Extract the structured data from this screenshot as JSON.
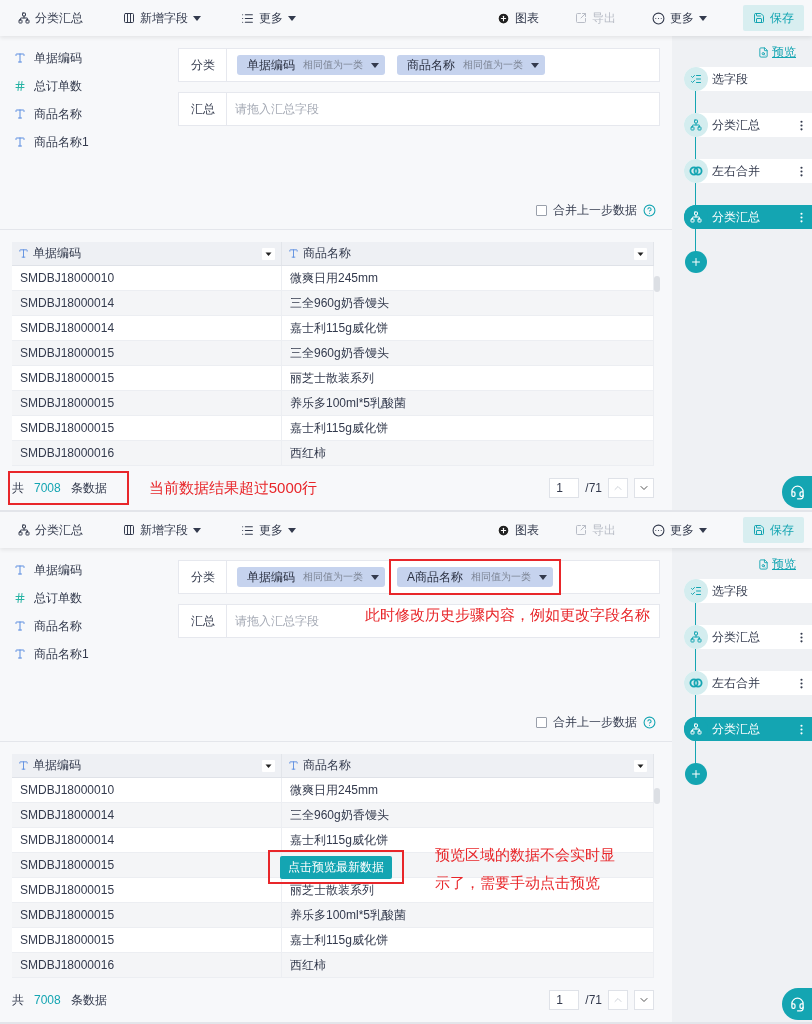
{
  "panels": [
    {
      "toolbar": {
        "left": [
          {
            "kind": "summary",
            "label": "分类汇总",
            "dropdown": false
          },
          {
            "kind": "add-field",
            "label": "新增字段",
            "dropdown": true
          },
          {
            "kind": "more",
            "label": "更多",
            "dropdown": true
          }
        ],
        "right": [
          {
            "kind": "chart",
            "label": "图表",
            "dropdown": false,
            "disabled": false
          },
          {
            "kind": "export",
            "label": "导出",
            "dropdown": false,
            "disabled": true
          },
          {
            "kind": "more-circle",
            "label": "更多",
            "dropdown": true,
            "disabled": false
          },
          {
            "kind": "save",
            "label": "保存",
            "dropdown": false,
            "disabled": false
          }
        ]
      },
      "fields": [
        {
          "kind": "text",
          "label": "单据编码"
        },
        {
          "kind": "number",
          "label": "总订单数"
        },
        {
          "kind": "text",
          "label": "商品名称"
        },
        {
          "kind": "text",
          "label": "商品名称1"
        }
      ],
      "config": {
        "group_label": "分类",
        "group_tags": [
          {
            "name": "单据编码",
            "hint": "相同值为一类",
            "highlighted": false
          },
          {
            "name": "商品名称",
            "hint": "相同值为一类",
            "highlighted": false
          }
        ],
        "summary_label": "汇总",
        "summary_placeholder": "请拖入汇总字段"
      },
      "merge_option": {
        "label": "合并上一步数据",
        "checked": false
      },
      "preview_link": "预览",
      "steps": [
        {
          "kind": "select",
          "label": "选字段",
          "selected": false,
          "menu": false
        },
        {
          "kind": "summary",
          "label": "分类汇总",
          "selected": false,
          "menu": true
        },
        {
          "kind": "merge",
          "label": "左右合并",
          "selected": false,
          "menu": true
        },
        {
          "kind": "summary",
          "label": "分类汇总",
          "selected": true,
          "menu": true
        }
      ],
      "table": {
        "columns": [
          {
            "label": "单据编码"
          },
          {
            "label": "商品名称"
          }
        ],
        "rows": [
          [
            "SMDBJ18000010",
            "微爽日用245mm"
          ],
          [
            "SMDBJ18000014",
            "三全960g奶香馒头"
          ],
          [
            "SMDBJ18000014",
            "嘉士利115g威化饼"
          ],
          [
            "SMDBJ18000015",
            "三全960g奶香馒头"
          ],
          [
            "SMDBJ18000015",
            "丽芝士散装系列"
          ],
          [
            "SMDBJ18000015",
            "养乐多100ml*5乳酸菌"
          ],
          [
            "SMDBJ18000015",
            "嘉士利115g威化饼"
          ],
          [
            "SMDBJ18000016",
            "西红柿"
          ]
        ]
      },
      "footer": {
        "prefix": "共",
        "count": "7008",
        "suffix": "条数据",
        "highlighted": true,
        "note": "当前数据结果超过5000行",
        "page": "1",
        "pages": "/71"
      }
    },
    {
      "toolbar": {
        "left": [
          {
            "kind": "summary",
            "label": "分类汇总",
            "dropdown": false
          },
          {
            "kind": "add-field",
            "label": "新增字段",
            "dropdown": true
          },
          {
            "kind": "more",
            "label": "更多",
            "dropdown": true
          }
        ],
        "right": [
          {
            "kind": "chart",
            "label": "图表",
            "dropdown": false,
            "disabled": false
          },
          {
            "kind": "export",
            "label": "导出",
            "dropdown": false,
            "disabled": true
          },
          {
            "kind": "more-circle",
            "label": "更多",
            "dropdown": true,
            "disabled": false
          },
          {
            "kind": "save",
            "label": "保存",
            "dropdown": false,
            "disabled": false
          }
        ]
      },
      "fields": [
        {
          "kind": "text",
          "label": "单据编码"
        },
        {
          "kind": "number",
          "label": "总订单数"
        },
        {
          "kind": "text",
          "label": "商品名称"
        },
        {
          "kind": "text",
          "label": "商品名称1"
        }
      ],
      "config": {
        "group_label": "分类",
        "group_tags": [
          {
            "name": "单据编码",
            "hint": "相同值为一类",
            "highlighted": false
          },
          {
            "name": "A商品名称",
            "hint": "相同值为一类",
            "highlighted": true
          }
        ],
        "summary_label": "汇总",
        "summary_placeholder": "请拖入汇总字段",
        "note": "此时修改历史步骤内容，例如更改字段名称"
      },
      "merge_option": {
        "label": "合并上一步数据",
        "checked": false
      },
      "preview_link": "预览",
      "steps": [
        {
          "kind": "select",
          "label": "选字段",
          "selected": false,
          "menu": false
        },
        {
          "kind": "summary",
          "label": "分类汇总",
          "selected": false,
          "menu": true
        },
        {
          "kind": "merge",
          "label": "左右合并",
          "selected": false,
          "menu": true
        },
        {
          "kind": "summary",
          "label": "分类汇总",
          "selected": true,
          "menu": true
        }
      ],
      "table": {
        "columns": [
          {
            "label": "单据编码"
          },
          {
            "label": "商品名称"
          }
        ],
        "rows": [
          [
            "SMDBJ18000010",
            "微爽日用245mm"
          ],
          [
            "SMDBJ18000014",
            "三全960g奶香馒头"
          ],
          [
            "SMDBJ18000014",
            "嘉士利115g威化饼"
          ],
          [
            "SMDBJ18000015"
          ],
          [
            "SMDBJ18000015",
            "丽芝士散装系列"
          ],
          [
            "SMDBJ18000015",
            "养乐多100ml*5乳酸菌"
          ],
          [
            "SMDBJ18000015",
            "嘉士利115g威化饼"
          ],
          [
            "SMDBJ18000016",
            "西红柿"
          ]
        ],
        "overlay": {
          "button": "点击预览最新数据",
          "highlighted": true,
          "note": "预览区域的数据不会实时显示了，需要手动点击预览"
        }
      },
      "footer": {
        "prefix": "共",
        "count": "7008",
        "suffix": "条数据",
        "highlighted": false,
        "page": "1",
        "pages": "/71"
      }
    }
  ]
}
